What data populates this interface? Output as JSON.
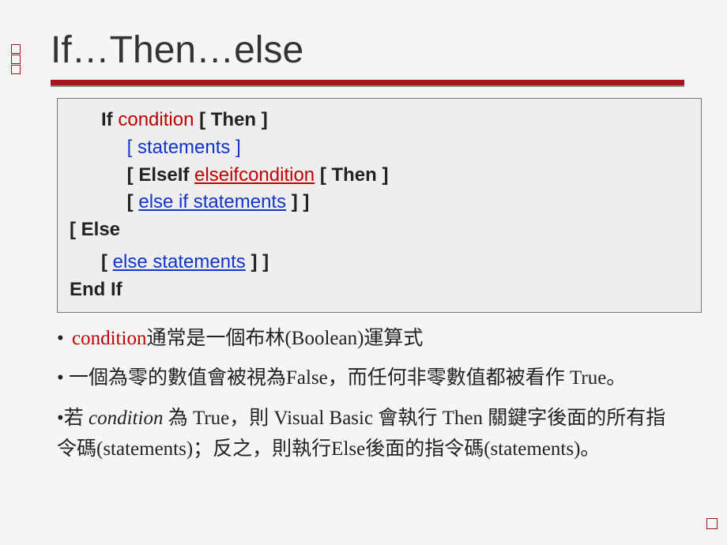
{
  "title": "If…Then…else",
  "code": {
    "l1a": "If",
    "l1b": "condition",
    "l1c": "[ Then ]",
    "l2": "[ statements ]",
    "l3a": "[ ElseIf",
    "l3b": "elseifcondition",
    "l3c": "[ Then ]",
    "l4a": "[",
    "l4b": "else if statements",
    "l4c": "] ]",
    "l5": "[ Else",
    "l6a": "[",
    "l6b": "else statements",
    "l6c": "] ]",
    "l7": "End If"
  },
  "notes": {
    "n1a": "• ",
    "n1b": "condition",
    "n1c": "通常是一個布林(Boolean)運算式",
    "n2": "• 一個為零的數值會被視為False，而任何非零數值都被看作 True。",
    "n3a": "•若 ",
    "n3b": "condition",
    "n3c": " 為 True，則 Visual Basic 會執行 Then 關鍵字後面的所有指令碼(statements)；反之，則執行Else後面的指令碼(statements)。"
  }
}
